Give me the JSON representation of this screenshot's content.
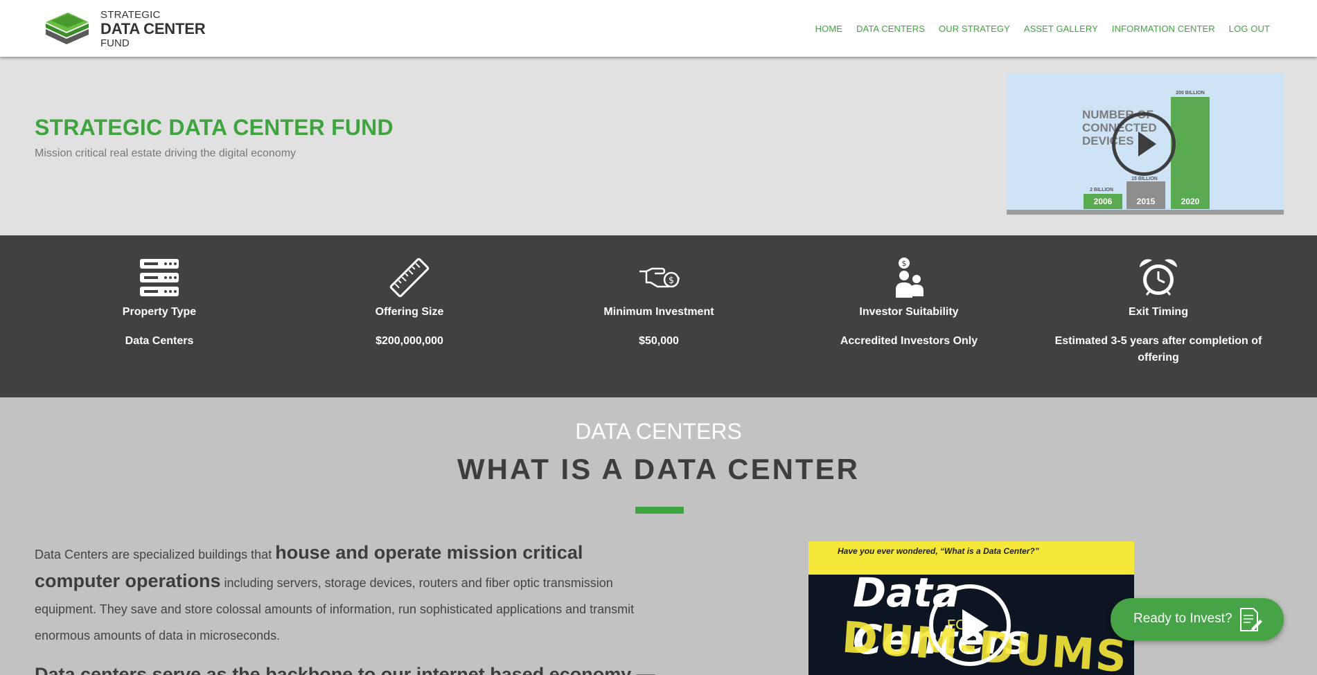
{
  "header": {
    "logo": {
      "line1": "STRATEGIC",
      "line2": "DATA CENTER",
      "line3": "FUND"
    },
    "nav": [
      "HOME",
      "DATA CENTERS",
      "OUR STRATEGY",
      "ASSET GALLERY",
      "INFORMATION CENTER",
      "LOG OUT"
    ]
  },
  "hero": {
    "title": "STRATEGIC DATA CENTER FUND",
    "subtitle": "Mission critical real estate driving the digital economy",
    "video": {
      "caption": [
        "NUMBER OF",
        "CONNECTED",
        "DEVICES"
      ],
      "bars": [
        {
          "year": "2006",
          "value_label": "2 BILLION"
        },
        {
          "year": "2015",
          "value_label": "15 BILLION"
        },
        {
          "year": "2020",
          "value_label": "200 BILLION"
        }
      ]
    }
  },
  "stats": [
    {
      "icon": "server-icon",
      "label": "Property Type",
      "value": "Data Centers"
    },
    {
      "icon": "ruler-icon",
      "label": "Offering Size",
      "value": "$200,000,000"
    },
    {
      "icon": "hand-money-icon",
      "label": "Minimum Investment",
      "value": "$50,000"
    },
    {
      "icon": "investors-icon",
      "label": "Investor Suitability",
      "value": "Accredited Investors Only"
    },
    {
      "icon": "alarm-clock-icon",
      "label": "Exit Timing",
      "value": "Estimated 3-5 years after completion of offering"
    }
  ],
  "data_centers": {
    "kicker": "DATA CENTERS",
    "heading": "WHAT IS A DATA CENTER",
    "para_lead": "Data Centers are specialized buildings that ",
    "para_bold": "house and operate mission critical computer operations",
    "para_rest": " including servers, storage devices, routers and fiber optic transmission equipment. They save and store colossal amounts of information, run sophisticated applications and transmit enormous amounts of data in microseconds.",
    "para2": "Data centers serve as the backbone to our internet based economy —",
    "video": {
      "question": "Have you ever wondered, “What is a Data Center?”",
      "title": "Data Centers",
      "for": "FOR",
      "subtitle": "DUM-DUMS"
    }
  },
  "cta": {
    "label": "Ready to Invest?"
  },
  "colors": {
    "brand_green": "#3fa43f",
    "dark_band": "#414143",
    "hero_bg": "#e1e1e1",
    "section_bg": "#c2c2c2"
  }
}
